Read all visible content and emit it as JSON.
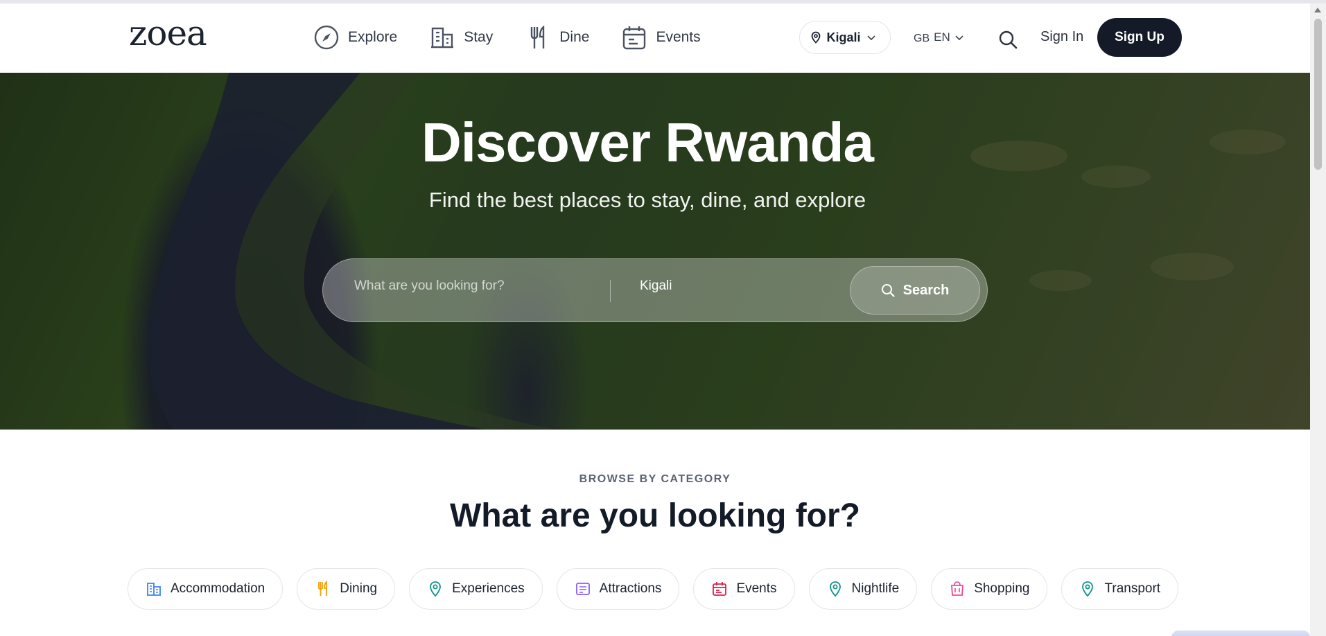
{
  "header": {
    "logo": "zoea",
    "nav": [
      {
        "label": "Explore",
        "icon": "compass-icon"
      },
      {
        "label": "Stay",
        "icon": "building-icon"
      },
      {
        "label": "Dine",
        "icon": "utensils-icon"
      },
      {
        "label": "Events",
        "icon": "calendar-icon"
      }
    ],
    "location": "Kigali",
    "language": {
      "flag": "GB",
      "code": "EN"
    },
    "sign_in": "Sign In",
    "sign_up": "Sign Up"
  },
  "hero": {
    "title": "Discover Rwanda",
    "subtitle": "Find the best places to stay, dine, and explore",
    "search": {
      "placeholder": "What are you looking for?",
      "location_value": "Kigali",
      "button": "Search"
    }
  },
  "category": {
    "eyebrow": "BROWSE BY CATEGORY",
    "title": "What are you looking for?",
    "chips": [
      {
        "label": "Accommodation",
        "icon": "building-icon",
        "color": "#3b82f6"
      },
      {
        "label": "Dining",
        "icon": "utensils-icon",
        "color": "#f59e0b"
      },
      {
        "label": "Experiences",
        "icon": "map-pin-icon",
        "color": "#0d9488"
      },
      {
        "label": "Attractions",
        "icon": "ticket-icon",
        "color": "#8b5cf6"
      },
      {
        "label": "Events",
        "icon": "calendar-icon",
        "color": "#e11d48"
      },
      {
        "label": "Nightlife",
        "icon": "map-pin-icon",
        "color": "#0d9488"
      },
      {
        "label": "Shopping",
        "icon": "shopping-bag-icon",
        "color": "#ec4899"
      },
      {
        "label": "Transport",
        "icon": "map-pin-icon",
        "color": "#0d9488"
      }
    ]
  },
  "colors": {
    "primary_dark": "#141a28",
    "accent_teal": "#0d9488"
  }
}
